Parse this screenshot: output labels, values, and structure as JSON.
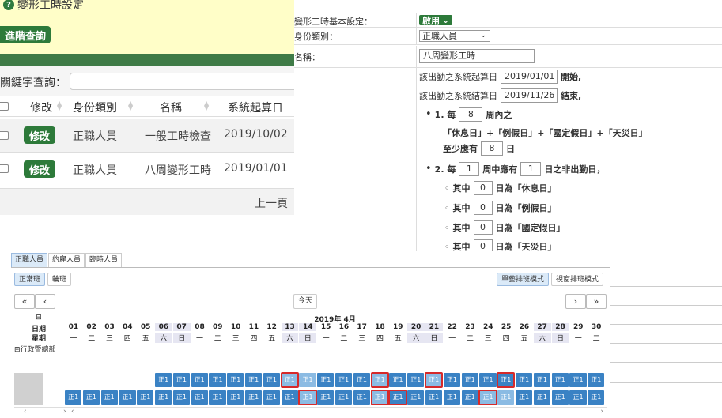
{
  "left": {
    "title": "變形工時設定",
    "help_icon": "question-circle-icon",
    "advanced_search": "進階查詢",
    "search_label": "關鍵字查詢：",
    "columns": [
      "修改",
      "身份類別",
      "名稱",
      "系統起算日"
    ],
    "rows": [
      {
        "edit": "修改",
        "type": "正職人員",
        "name": "一般工時檢查",
        "date": "2019/10/02"
      },
      {
        "edit": "修改",
        "type": "正職人員",
        "name": "八周變形工時",
        "date": "2019/01/01"
      }
    ],
    "prev_page": "上一頁"
  },
  "right": {
    "basic_label": "變形工時基本設定：",
    "enable": "啟用",
    "identity_label": "身份類別：",
    "identity_value": "正職人員",
    "name_label": "名稱：",
    "name_value": "八周變形工時",
    "start_prefix": "該出勤之系統起算日",
    "start_date": "2019/01/01",
    "start_suffix": "開始,",
    "end_prefix": "該出勤之系統結算日",
    "end_date": "2019/11/26",
    "end_suffix": "結束,",
    "rule1_prefix": "1. 每",
    "rule1_weeks": "8",
    "rule1_suffix": "周內之",
    "rule1_days_text": "「休息日」+「例假日」+「國定假日」+「天災日」",
    "min_prefix": "至少應有",
    "min_value": "8",
    "min_suffix": "日",
    "rule2_prefix": "2. 每",
    "rule2_weeks": "1",
    "rule2_mid": "周中應有",
    "rule2_days": "1",
    "rule2_suffix": "日之非出勤日，",
    "sub_items": [
      {
        "prefix": "其中",
        "value": "0",
        "suffix": "日為「休息日」"
      },
      {
        "prefix": "其中",
        "value": "0",
        "suffix": "日為「例假日」"
      },
      {
        "prefix": "其中",
        "value": "0",
        "suffix": "日為「國定假日」"
      },
      {
        "prefix": "其中",
        "value": "0",
        "suffix": "日為「天災日」"
      }
    ]
  },
  "scheduler": {
    "main_tabs": [
      "正職人員",
      "約雇人員",
      "臨時人員"
    ],
    "sub_tabs": [
      "正常班",
      "輪班"
    ],
    "mode_buttons": [
      "單藝排班模式",
      "視窗排班模式"
    ],
    "nav_first": "«",
    "nav_prev": "‹",
    "today": "今天",
    "nav_next": "›",
    "nav_last": "»",
    "collapse": "⊟",
    "month_label": "2019年 4月",
    "date_label": "日期",
    "weekday_label": "星期",
    "dept": "⊟行政暨總部",
    "days": [
      "01",
      "02",
      "03",
      "04",
      "05",
      "06",
      "07",
      "08",
      "09",
      "10",
      "11",
      "12",
      "13",
      "14",
      "15",
      "16",
      "17",
      "18",
      "19",
      "20",
      "21",
      "22",
      "23",
      "24",
      "25",
      "26",
      "27",
      "28",
      "29",
      "30"
    ],
    "weekdays": [
      "一",
      "二",
      "三",
      "四",
      "五",
      "六",
      "日",
      "一",
      "二",
      "三",
      "四",
      "五",
      "六",
      "日",
      "一",
      "二",
      "三",
      "四",
      "五",
      "六",
      "日",
      "一",
      "二",
      "三",
      "四",
      "五",
      "六",
      "日",
      "一",
      "二"
    ],
    "shift_label": "正1",
    "scroll_left": "‹",
    "scroll_right": "›"
  }
}
